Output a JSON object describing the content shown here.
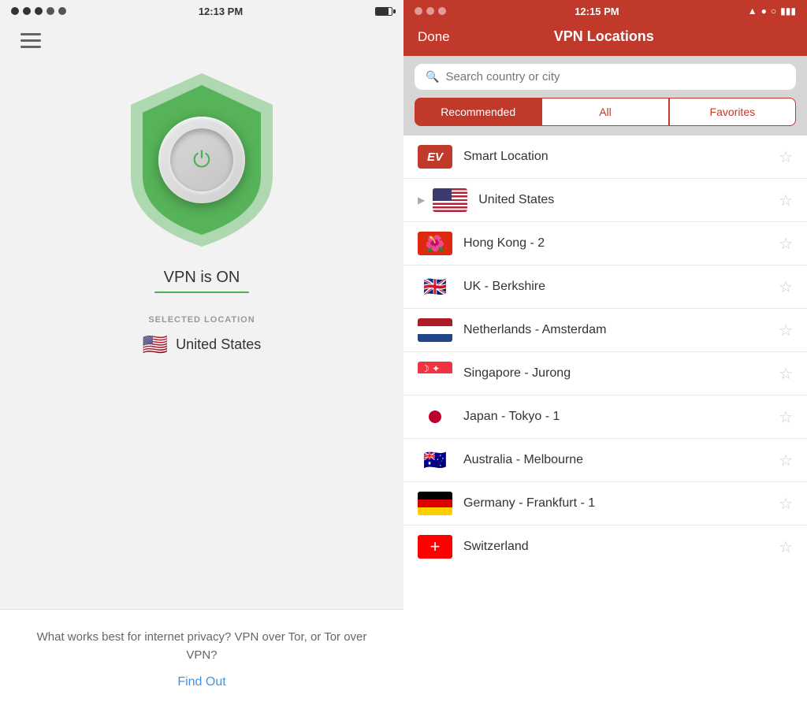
{
  "left": {
    "statusBar": {
      "time": "12:13 PM"
    },
    "vpnStatus": "VPN is ON",
    "selectedLocationLabel": "SELECTED LOCATION",
    "selectedLocation": "United States",
    "bottomCard": {
      "text": "What works best for internet privacy? VPN over Tor, or Tor over VPN?",
      "linkText": "Find Out"
    }
  },
  "right": {
    "statusBar": {
      "time": "12:15 PM"
    },
    "header": {
      "doneLabel": "Done",
      "title": "VPN Locations"
    },
    "search": {
      "placeholder": "Search country or city"
    },
    "tabs": [
      {
        "label": "Recommended",
        "active": true
      },
      {
        "label": "All",
        "active": false
      },
      {
        "label": "Favorites",
        "active": false
      }
    ],
    "locations": [
      {
        "id": "smart",
        "name": "Smart Location",
        "type": "smart"
      },
      {
        "id": "us",
        "name": "United States",
        "type": "us",
        "expandable": true
      },
      {
        "id": "hk",
        "name": "Hong Kong - 2",
        "type": "hk"
      },
      {
        "id": "uk",
        "name": "UK - Berkshire",
        "type": "uk"
      },
      {
        "id": "nl",
        "name": "Netherlands - Amsterdam",
        "type": "nl"
      },
      {
        "id": "sg",
        "name": "Singapore - Jurong",
        "type": "sg"
      },
      {
        "id": "jp",
        "name": "Japan - Tokyo - 1",
        "type": "jp"
      },
      {
        "id": "au",
        "name": "Australia - Melbourne",
        "type": "au"
      },
      {
        "id": "de",
        "name": "Germany - Frankfurt - 1",
        "type": "de"
      },
      {
        "id": "ch",
        "name": "Switzerland",
        "type": "ch"
      }
    ]
  }
}
